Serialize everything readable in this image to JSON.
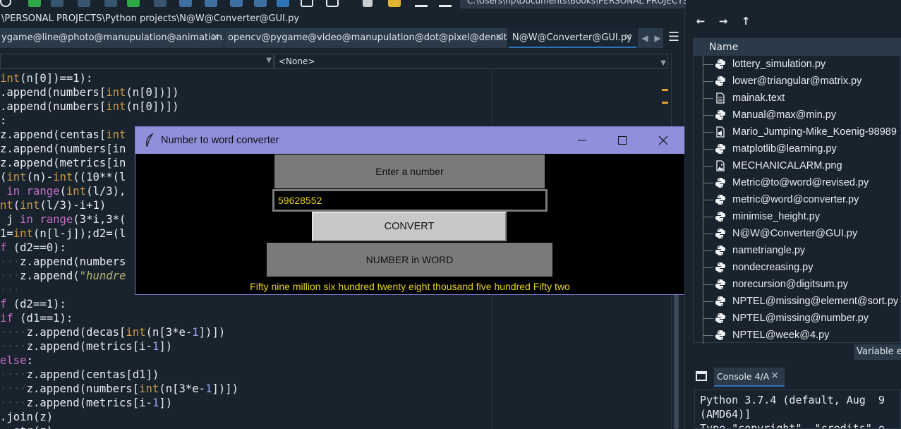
{
  "toolbar": {
    "path": "C:\\Users\\hp\\Documents\\Books\\PERSONAL PROJECTS\\Python projects"
  },
  "editor": {
    "path": "\\PERSONAL PROJECTS\\Python projects\\N@W@Converter@GUI.py",
    "tabs": [
      {
        "label": "ygame@line@photo@manupulation@animation.py"
      },
      {
        "label": "opencv@pygame@video@manupulation@dot@pixel@densitty.py"
      },
      {
        "label": "N@W@Converter@GUI.py"
      }
    ],
    "combo_right": "<None>",
    "code_lines": [
      [
        [
          "fn",
          "int"
        ],
        [
          "p",
          "(n[0])==1):"
        ]
      ],
      [
        [
          "p",
          ".append(numbers["
        ],
        [
          "fn",
          "int"
        ],
        [
          "p",
          "(n[0])])"
        ]
      ],
      [
        [
          "p",
          ".append(numbers["
        ],
        [
          "fn",
          "int"
        ],
        [
          "p",
          "(n[0])])"
        ]
      ],
      [
        [
          "p",
          ":"
        ]
      ],
      [
        [
          "p",
          "z.append(centas["
        ],
        [
          "fn",
          "int"
        ]
      ],
      [
        [
          "p",
          "z.append(numbers[in"
        ]
      ],
      [
        [
          "p",
          "z.append(metrics[in"
        ]
      ],
      [
        [
          "p",
          "("
        ],
        [
          "fn",
          "int"
        ],
        [
          "p",
          "(n)-"
        ],
        [
          "fn",
          "int"
        ],
        [
          "p",
          "((10**(l"
        ]
      ],
      [
        [
          "ind",
          " "
        ],
        [
          "kw",
          "in"
        ],
        [
          "p",
          " "
        ],
        [
          "kw",
          "range"
        ],
        [
          "p",
          "("
        ],
        [
          "fn",
          "int"
        ],
        [
          "p",
          "(l/3),"
        ]
      ],
      [
        [
          "fn",
          "nt"
        ],
        [
          "p",
          "("
        ],
        [
          "fn",
          "int"
        ],
        [
          "p",
          "(l/3)-i+1)"
        ]
      ],
      [
        [
          "ind",
          " "
        ],
        [
          "p",
          "j "
        ],
        [
          "kw",
          "in"
        ],
        [
          "p",
          " "
        ],
        [
          "kw",
          "range"
        ],
        [
          "p",
          "(3*i,3*("
        ]
      ],
      [
        [
          "p",
          "1="
        ],
        [
          "fn",
          "int"
        ],
        [
          "p",
          "(n[l-j]);d2=(l"
        ]
      ],
      [
        [
          "kw",
          "f"
        ],
        [
          "p",
          " (d2==0):"
        ]
      ],
      [
        [
          "ind",
          "···"
        ],
        [
          "p",
          "z.append(numbers"
        ]
      ],
      [
        [
          "ind",
          "···"
        ],
        [
          "p",
          "z.append("
        ],
        [
          "str",
          "\"hundre"
        ]
      ],
      [
        [
          "ind",
          "···"
        ]
      ],
      [
        [
          "kw",
          "f"
        ],
        [
          "p",
          " (d2==1):"
        ]
      ],
      [
        [
          "kw",
          "if"
        ],
        [
          "p",
          " (d1==1):"
        ]
      ],
      [
        [
          "ind",
          "····"
        ],
        [
          "p",
          "z.append(decas["
        ],
        [
          "fn",
          "int"
        ],
        [
          "p",
          "(n[3*e-"
        ],
        [
          "num",
          "1"
        ],
        [
          "p",
          "])])"
        ]
      ],
      [
        [
          "ind",
          "····"
        ],
        [
          "p",
          "z.append(metrics[i-"
        ],
        [
          "num",
          "1"
        ],
        [
          "p",
          "])"
        ]
      ],
      [
        [
          "kw",
          "else"
        ],
        [
          "p",
          ":"
        ]
      ],
      [
        [
          "ind",
          "····"
        ],
        [
          "p",
          "z.append(centas[d1])"
        ]
      ],
      [
        [
          "ind",
          "····"
        ],
        [
          "p",
          "z.append(numbers["
        ],
        [
          "fn",
          "int"
        ],
        [
          "p",
          "(n[3*e-"
        ],
        [
          "num",
          "1"
        ],
        [
          "p",
          "])])"
        ]
      ],
      [
        [
          "ind",
          "····"
        ],
        [
          "p",
          "z.append(metrics[i-"
        ],
        [
          "num",
          "1"
        ],
        [
          "p",
          "])"
        ]
      ],
      [
        [
          "p",
          ".join(z)"
        ]
      ],
      [
        [
          "p",
          "  str(z)"
        ]
      ]
    ]
  },
  "dialog": {
    "title": "Number to word converter",
    "enter_label": "Enter a number",
    "input_value": "59628552",
    "convert_label": "CONVERT",
    "word_label": "NUMBER in WORD",
    "result": "Fifty nine million six hundred twenty eight thousand five hundred Fifty two",
    "minimize": "—",
    "maximize": "☐",
    "close": "✕",
    "colors": {
      "title_bg": "#8f8fdc",
      "result_text": "#e8d21c"
    }
  },
  "files": {
    "header": "Name",
    "items": [
      {
        "name": "lottery_simulation.py",
        "icon": "python-file-icon"
      },
      {
        "name": "lower@triangular@matrix.py",
        "icon": "python-file-icon"
      },
      {
        "name": "mainak.text",
        "icon": "text-file-icon"
      },
      {
        "name": "Manual@max@min.py",
        "icon": "python-file-icon"
      },
      {
        "name": "Mario_Jumping-Mike_Koenig-98989",
        "icon": "audio-file-icon"
      },
      {
        "name": "matplotlib@learning.py",
        "icon": "python-file-icon"
      },
      {
        "name": "MECHANICALARM.png",
        "icon": "image-file-icon"
      },
      {
        "name": "Metric@to@word@revised.py",
        "icon": "python-file-icon"
      },
      {
        "name": "metric@word@converter.py",
        "icon": "python-file-icon"
      },
      {
        "name": "minimise_height.py",
        "icon": "python-file-icon"
      },
      {
        "name": "N@W@Converter@GUI.py",
        "icon": "python-file-icon"
      },
      {
        "name": "nametriangle.py",
        "icon": "python-file-icon"
      },
      {
        "name": "nondecreasing.py",
        "icon": "python-file-icon"
      },
      {
        "name": "norecursion@digitsum.py",
        "icon": "python-file-icon"
      },
      {
        "name": "NPTEL@missing@element@sort.py",
        "icon": "python-file-icon"
      },
      {
        "name": "NPTEL@missing@number.py",
        "icon": "python-file-icon"
      },
      {
        "name": "NPTEL@week@4.py",
        "icon": "python-file-icon"
      }
    ],
    "variable_tab": "Variable ex"
  },
  "nav": {
    "back": "←",
    "forward": "→",
    "up": "↑"
  },
  "console": {
    "tab_label": "Console 4/A",
    "lines": [
      "Python 3.7.4 (default, Aug  9",
      "(AMD64)]",
      "Type \"copyright\", \"credits\" o"
    ]
  }
}
